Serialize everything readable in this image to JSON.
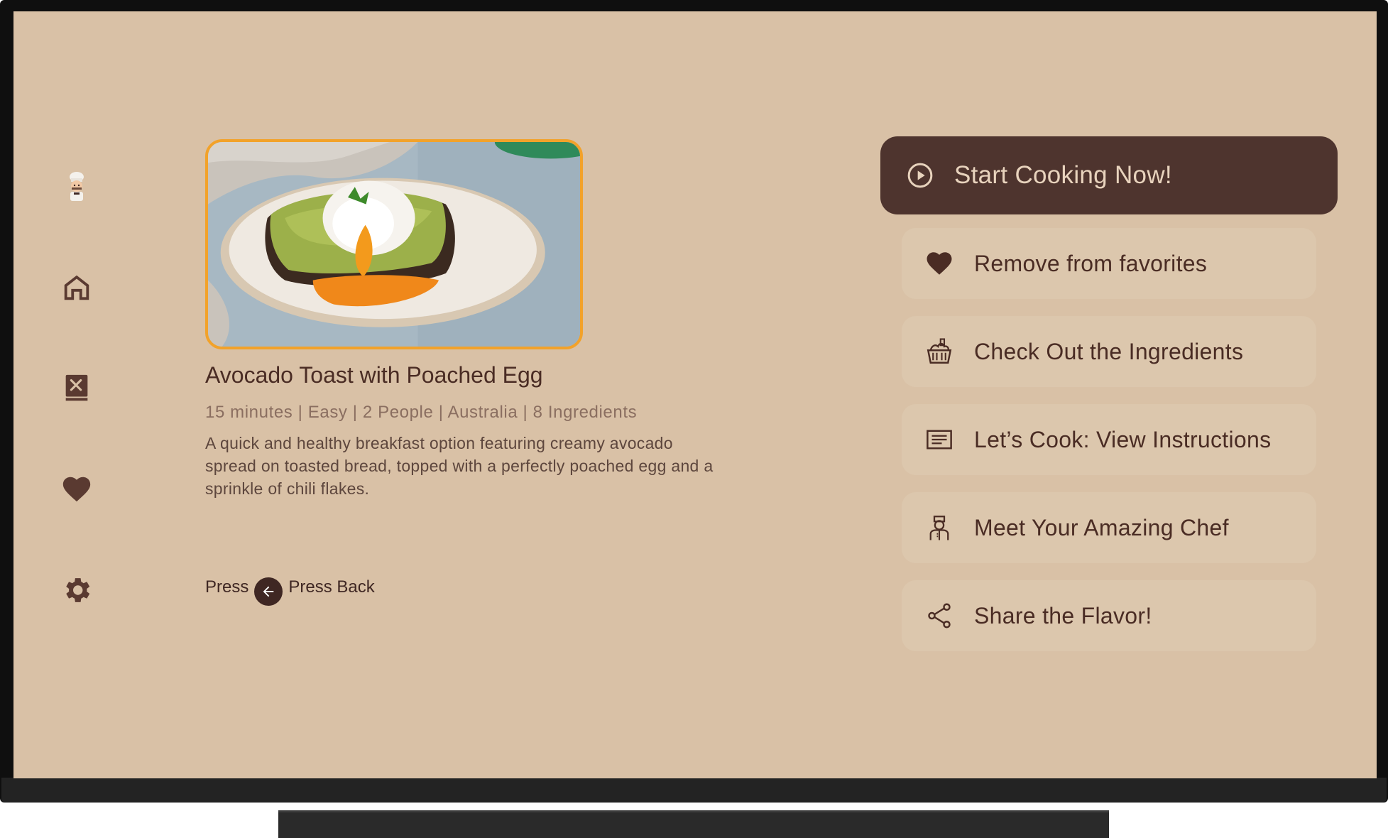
{
  "nav": {
    "items": [
      {
        "name": "chef-avatar",
        "icon": "chef-avatar-icon"
      },
      {
        "name": "home",
        "icon": "home-icon"
      },
      {
        "name": "recipes",
        "icon": "recipe-book-icon"
      },
      {
        "name": "favorites",
        "icon": "heart-icon"
      },
      {
        "name": "settings",
        "icon": "gear-icon"
      }
    ]
  },
  "recipe": {
    "image_alt": "avocado-toast-with-poached-egg-photo",
    "title": "Avocado Toast with Poached Egg",
    "meta": "15 minutes | Easy | 2 People  | Australia | 8 Ingredients",
    "description": "A quick and healthy breakfast option featuring creamy avocado spread on toasted bread, topped with a perfectly poached egg and a sprinkle of chili flakes."
  },
  "back_hint": {
    "prefix": "Press",
    "suffix": "Press Back"
  },
  "actions": {
    "primary": {
      "label": "Start Cooking Now!",
      "icon": "play-circle-icon"
    },
    "items": [
      {
        "label": "Remove from favorites",
        "icon": "heart-icon"
      },
      {
        "label": "Check Out the Ingredients",
        "icon": "basket-icon"
      },
      {
        "label": "Let’s Cook: View Instructions",
        "icon": "instructions-icon"
      },
      {
        "label": "Meet Your Amazing Chef",
        "icon": "chef-icon"
      },
      {
        "label": "Share the Flavor!",
        "icon": "share-icon"
      }
    ]
  },
  "colors": {
    "background": "#d9c1a6",
    "primary_button": "#4e342e",
    "secondary_button": "#dcc7ad",
    "accent_border": "#f2a22a",
    "text_dark": "#4a2c24"
  }
}
